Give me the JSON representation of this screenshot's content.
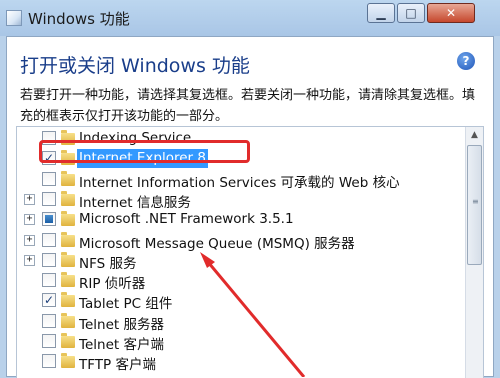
{
  "window": {
    "title": "Windows 功能",
    "controls": {
      "minimize": "▁",
      "maximize": "□",
      "close": "✕"
    }
  },
  "dialog": {
    "heading": "打开或关闭 Windows 功能",
    "help": "?",
    "description": "若要打开一种功能，请选择其复选框。若要关闭一种功能，请清除其复选框。填充的框表示仅打开该功能的一部分。"
  },
  "features": [
    {
      "label": "Indexing Service",
      "state": "unchecked",
      "expandable": false
    },
    {
      "label": "Internet Explorer 8",
      "state": "checked",
      "expandable": false,
      "selected": true,
      "highlighted": true
    },
    {
      "label": "Internet Information Services 可承载的 Web 核心",
      "state": "unchecked",
      "expandable": false
    },
    {
      "label": "Internet 信息服务",
      "state": "unchecked",
      "expandable": true
    },
    {
      "label": "Microsoft .NET Framework 3.5.1",
      "state": "partial",
      "expandable": true
    },
    {
      "label": "Microsoft Message Queue (MSMQ) 服务器",
      "state": "unchecked",
      "expandable": true
    },
    {
      "label": "NFS 服务",
      "state": "unchecked",
      "expandable": true
    },
    {
      "label": "RIP 侦听器",
      "state": "unchecked",
      "expandable": false
    },
    {
      "label": "Tablet PC 组件",
      "state": "checked",
      "expandable": false
    },
    {
      "label": "Telnet 服务器",
      "state": "unchecked",
      "expandable": false
    },
    {
      "label": "Telnet 客户端",
      "state": "unchecked",
      "expandable": false
    },
    {
      "label": "TFTP 客户端",
      "state": "unchecked",
      "expandable": false
    }
  ],
  "colors": {
    "annotation": "#e12b2b",
    "selection": "#3399ff",
    "heading": "#1a3e8a"
  }
}
